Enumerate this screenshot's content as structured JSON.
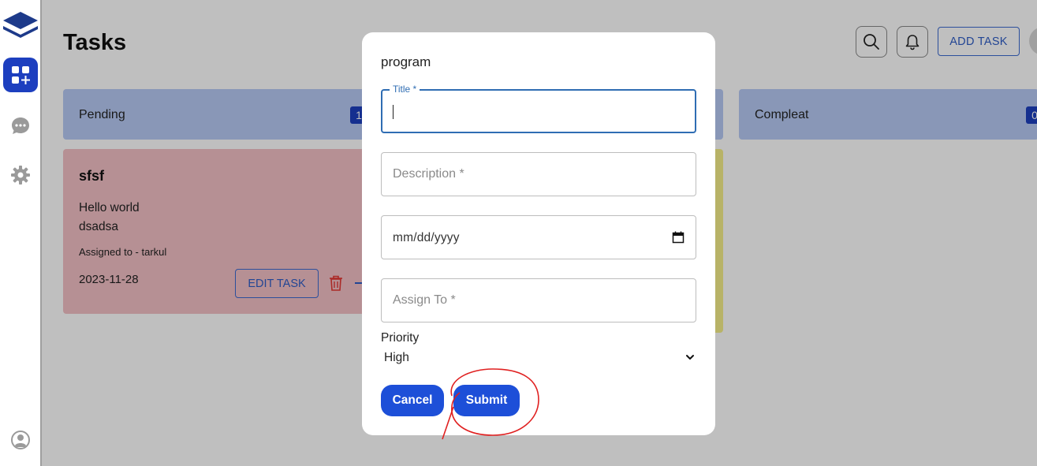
{
  "page": {
    "title": "Tasks"
  },
  "header": {
    "add_task_label": "ADD TASK",
    "icons": [
      "search-icon",
      "bell-icon"
    ]
  },
  "sidebar": {
    "icons": [
      "layers-logo-icon",
      "dashboard-add-icon",
      "chat-icon",
      "gear-icon",
      "user-icon"
    ]
  },
  "columns": [
    {
      "label": "Pending",
      "count": "1"
    },
    {
      "label": "Compleat",
      "count": "0"
    }
  ],
  "task": {
    "title": "sfsf",
    "description_line1": "Hello world",
    "description_line2": "dsadsa",
    "assigned": "Assigned to - tarkul",
    "date": "2023-11-28",
    "edit_label": "EDIT TASK"
  },
  "modal": {
    "title": "program",
    "title_label": "Title *",
    "description_placeholder": "Description *",
    "date_placeholder": "mm/dd/yyyy",
    "assign_placeholder": "Assign To *",
    "priority_label": "Priority",
    "priority_value": "High",
    "cancel_label": "Cancel",
    "submit_label": "Submit"
  },
  "colors": {
    "primary": "#1d4fd8",
    "column_header": "#b7caf4",
    "card_pending": "#f3c1c6",
    "card_yellow": "#f6ef8a",
    "annotation": "#e02020"
  }
}
